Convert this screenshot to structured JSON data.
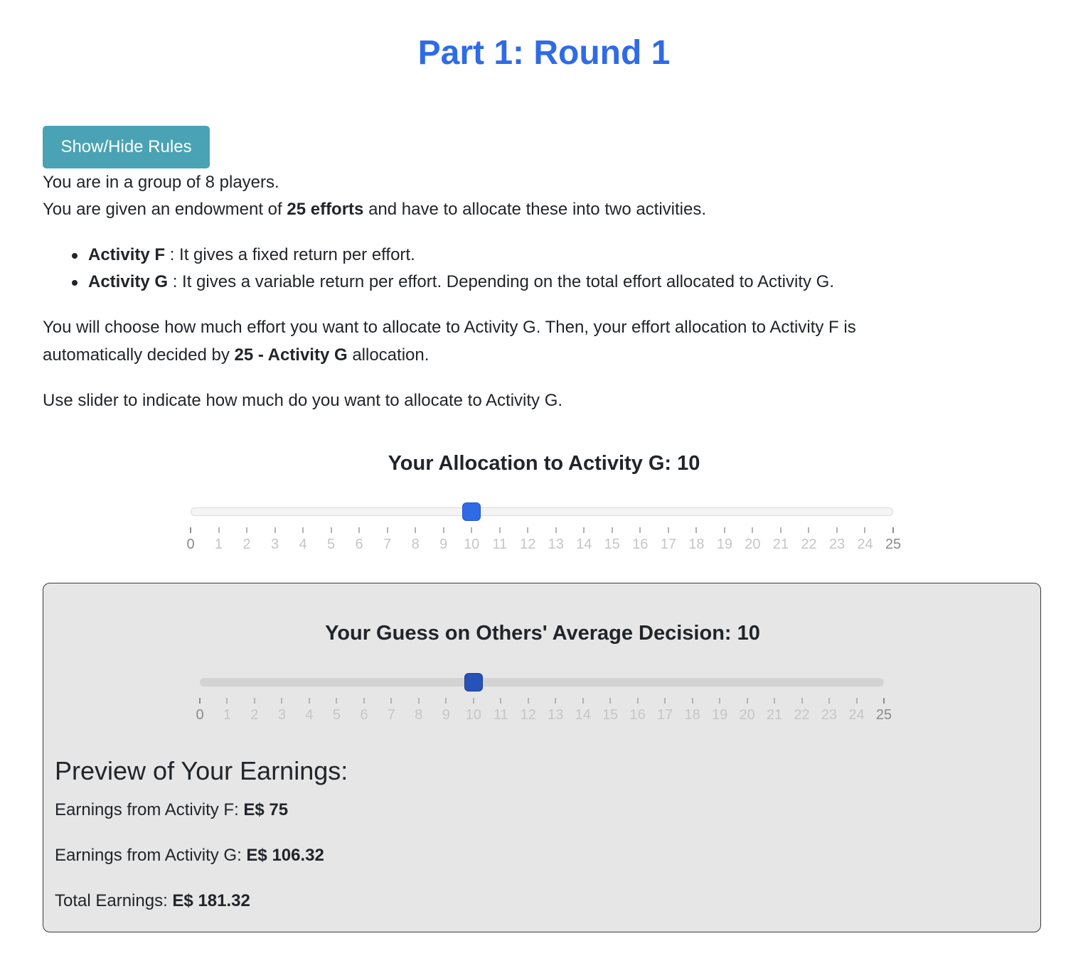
{
  "title": "Part 1: Round 1",
  "rules_button": "Show/Hide Rules",
  "intro": {
    "group_line": "You are in a group of 8 players.",
    "endowment_pre": "You are given an endowment of ",
    "endowment_bold": "25 efforts",
    "endowment_post": " and have to allocate these into two activities."
  },
  "activities": [
    {
      "name": "Activity F",
      "desc": " : It gives a fixed return per effort."
    },
    {
      "name": "Activity G",
      "desc": " : It gives a variable return per effort. Depending on the total effort allocated to Activity G."
    }
  ],
  "choose": {
    "line1": "You will choose how much effort you want to allocate to Activity G. Then, your effort allocation to Activity F is",
    "line2_pre": "automatically decided by ",
    "line2_bold": "25 - Activity G",
    "line2_post": " allocation."
  },
  "slider_instruction": "Use slider to indicate how much do you want to allocate to Activity G.",
  "allocation_slider": {
    "label": "Your Allocation to Activity G: 10",
    "min": 0,
    "max": 25,
    "value": 10
  },
  "guess_slider": {
    "label": "Your Guess on Others' Average Decision: 10",
    "min": 0,
    "max": 25,
    "value": 10
  },
  "preview": {
    "heading": "Preview of Your Earnings:",
    "f_label": "Earnings from Activity F: ",
    "f_value": "E$ 75",
    "g_label": "Earnings from Activity G: ",
    "g_value": "E$ 106.32",
    "total_label": "Total Earnings: ",
    "total_value": "E$ 181.32"
  },
  "colors": {
    "title": "#2f6be6",
    "button": "#4aa3b5",
    "thumb_allocation": "#2f6be6",
    "thumb_guess": "#2752b8",
    "panel_bg": "#e6e6e6"
  }
}
